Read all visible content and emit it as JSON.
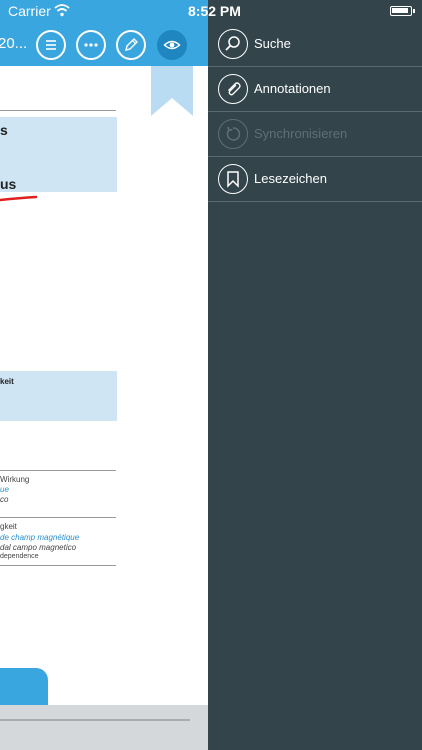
{
  "status": {
    "carrier": "Carrier",
    "time": "8:52 PM"
  },
  "toolbar": {
    "title_fragment": "20..."
  },
  "document": {
    "heading_fragment": "s",
    "heading_fragment_2": "us",
    "box2_text": "keit",
    "row1_line1": "Wirkung",
    "row1_line2": "ue",
    "row1_line3": "co",
    "row2_line1": "gkeit",
    "row2_line2": "de champ magnétique",
    "row2_line3": "dal campo magnetico",
    "row2_line4": "dependence"
  },
  "menu": {
    "items": [
      {
        "label": "Suche",
        "icon": "search-icon",
        "enabled": true
      },
      {
        "label": "Annotationen",
        "icon": "paperclip-icon",
        "enabled": true
      },
      {
        "label": "Synchronisieren",
        "icon": "sync-icon",
        "enabled": false
      },
      {
        "label": "Lesezeichen",
        "icon": "bookmark-icon",
        "enabled": true
      }
    ]
  },
  "colors": {
    "accent": "#3aa6e0",
    "menu_background": "#33444b",
    "highlight_box": "#cfe5f4",
    "annotation_red": "#e02020"
  }
}
